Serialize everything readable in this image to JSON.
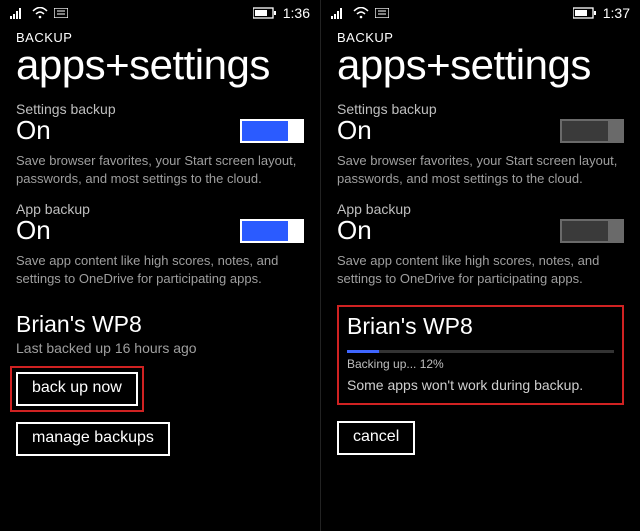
{
  "left": {
    "status": {
      "time": "1:36"
    },
    "header": {
      "small": "BACKUP",
      "title": "apps+settings"
    },
    "settings_backup": {
      "label": "Settings backup",
      "state": "On",
      "desc": "Save browser favorites, your Start screen layout, passwords, and most settings to the cloud."
    },
    "app_backup": {
      "label": "App backup",
      "state": "On",
      "desc": "Save app content like high scores, notes, and settings to OneDrive for participating apps."
    },
    "device": {
      "name": "Brian's WP8",
      "last": "Last backed up 16 hours ago"
    },
    "buttons": {
      "backup_now": "back up now",
      "manage": "manage backups"
    }
  },
  "right": {
    "status": {
      "time": "1:37"
    },
    "header": {
      "small": "BACKUP",
      "title": "apps+settings"
    },
    "settings_backup": {
      "label": "Settings backup",
      "state": "On",
      "desc": "Save browser favorites, your Start screen layout, passwords, and most settings to the cloud."
    },
    "app_backup": {
      "label": "App backup",
      "state": "On",
      "desc": "Save app content like high scores, notes, and settings to OneDrive for participating apps."
    },
    "device": {
      "name": "Brian's WP8",
      "progress_text": "Backing up... 12%",
      "progress_percent": "12",
      "message": "Some apps won't work during backup."
    },
    "buttons": {
      "cancel": "cancel"
    }
  },
  "colors": {
    "accent": "#2b5bff",
    "highlight": "#d02222"
  }
}
